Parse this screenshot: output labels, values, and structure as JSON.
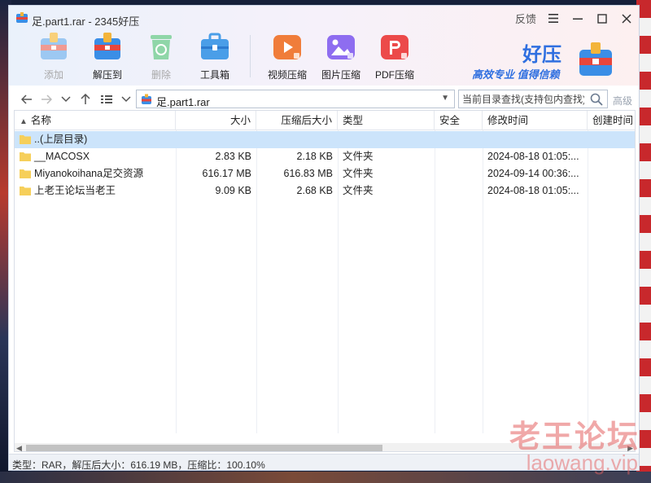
{
  "window": {
    "title": "足.part1.rar - 2345好压",
    "feedback_label": "反馈"
  },
  "toolbar": {
    "items": [
      {
        "label": "添加",
        "icon": "add-box-icon",
        "enabled": false
      },
      {
        "label": "解压到",
        "icon": "extract-box-icon",
        "enabled": true
      },
      {
        "label": "删除",
        "icon": "recycle-bin-icon",
        "enabled": false
      },
      {
        "label": "工具箱",
        "icon": "toolbox-icon",
        "enabled": true
      },
      {
        "label": "视频压缩",
        "icon": "video-compress-icon",
        "enabled": true
      },
      {
        "label": "图片压缩",
        "icon": "image-compress-icon",
        "enabled": true
      },
      {
        "label": "PDF压缩",
        "icon": "pdf-compress-icon",
        "enabled": true
      }
    ]
  },
  "brand": {
    "name": "好压",
    "slogan": "高效专业 值得信赖"
  },
  "address": {
    "path": "足.part1.rar",
    "search_placeholder": "当前目录查找(支持包内查找)",
    "advanced_label": "高级"
  },
  "table": {
    "columns": [
      "名称",
      "大小",
      "压缩后大小",
      "类型",
      "安全",
      "修改时间",
      "创建时间"
    ],
    "rows": [
      {
        "name": "..(上层目录)",
        "size": "",
        "packed": "",
        "type": "",
        "security": "",
        "modified": "",
        "created": "",
        "selected": true
      },
      {
        "name": "__MACOSX",
        "size": "2.83 KB",
        "packed": "2.18 KB",
        "type": "文件夹",
        "security": "",
        "modified": "2024-08-18 01:05:...",
        "created": "",
        "selected": false
      },
      {
        "name": "Miyanokoihana足交资源",
        "size": "616.17 MB",
        "packed": "616.83 MB",
        "type": "文件夹",
        "security": "",
        "modified": "2024-09-14 00:36:...",
        "created": "",
        "selected": false
      },
      {
        "name": "上老王论坛当老王",
        "size": "9.09 KB",
        "packed": "2.68 KB",
        "type": "文件夹",
        "security": "",
        "modified": "2024-08-18 01:05:...",
        "created": "",
        "selected": false
      }
    ]
  },
  "status": {
    "text": "类型：RAR，解压后大小：616.19 MB，压缩比：100.10%"
  },
  "watermark": {
    "title": "老王论坛",
    "url": "laowang.vip"
  },
  "colors": {
    "brand_blue": "#2f6fe0",
    "selection": "#cce4fb",
    "folder_yellow": "#f6cf5a",
    "watermark_red": "#e46060"
  }
}
